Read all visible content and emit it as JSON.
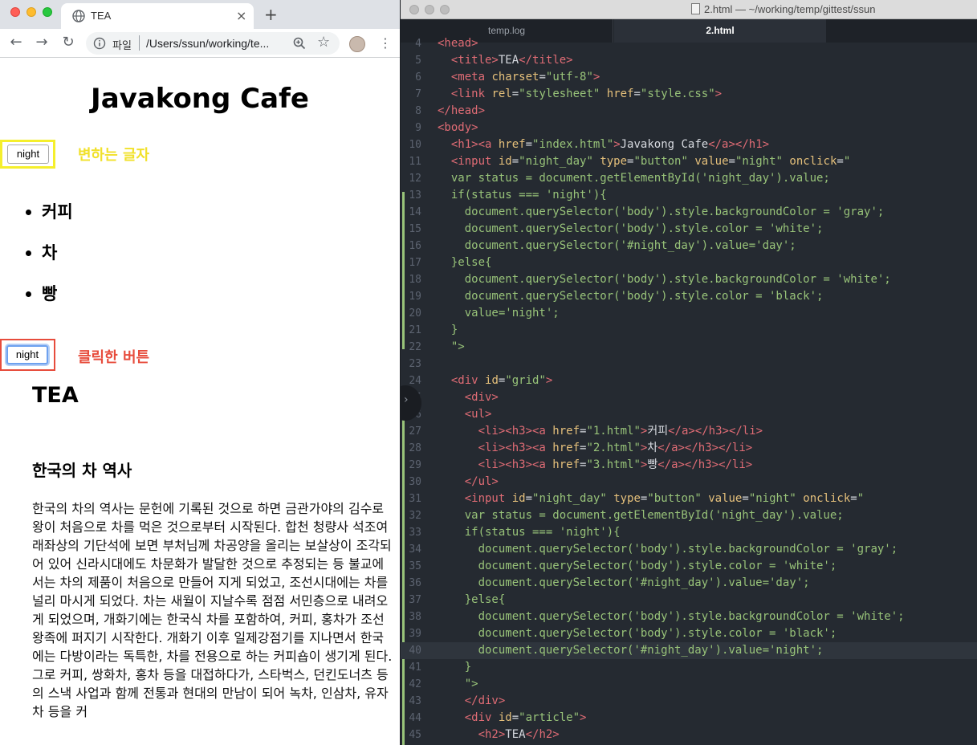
{
  "browser": {
    "tab_title": "TEA",
    "tab_close": "×",
    "new_tab": "+",
    "omnibox_file_label": "파일",
    "omnibox_url": "/Users/ssun/working/te...",
    "back": "←",
    "forward": "→",
    "reload": "↻",
    "star": "☆",
    "menu": "⋮"
  },
  "page": {
    "site_title": "Javakong Cafe",
    "night_button_top": "night",
    "callout_changing_text": "변하는 글자",
    "menu_items": [
      "커피",
      "차",
      "빵"
    ],
    "night_button_clicked": "night",
    "callout_clicked_button": "클릭한 버튼",
    "article_title": "TEA",
    "article_subtitle": "한국의 차 역사",
    "article_body": "한국의 차의 역사는 문헌에 기록된 것으로 하면 금관가야의 김수로 왕이 처음으로 차를 먹은 것으로부터 시작된다. 합천 청량사 석조여래좌상의 기단석에 보면 부처님께 차공양을 올리는 보살상이 조각되어 있어 신라시대에도 차문화가 발달한 것으로 추정되는 등 불교에서는 차의 제품이 처음으로 만들어 지게 되었고, 조선시대에는 차를 널리 마시게 되었다. 차는 새월이 지날수록 점점 서민층으로 내려오게 되었으며, 개화기에는 한국식 차를 포함하여, 커피, 홍차가 조선 왕족에 퍼지기 시작한다. 개화기 이후 일제강점기를 지나면서 한국에는 다방이라는 독특한, 차를 전용으로 하는 커피숍이 생기게 된다. 그로 커피, 쌍화차, 홍차 등을 대접하다가, 스타벅스, 던킨도너츠 등의 스낵 사업과 함께 전통과 현대의 만남이 되어 녹차, 인삼차, 유자차 등을 커"
  },
  "editor": {
    "window_title": "2.html — ~/working/temp/gittest/ssun",
    "tabs": [
      "temp.log",
      "2.html"
    ],
    "active_tab": "2.html",
    "lines": [
      {
        "n": "4",
        "t": [
          [
            "tag",
            "<head>"
          ]
        ]
      },
      {
        "n": "5",
        "t": [
          [
            "txt",
            "  "
          ],
          [
            "tag",
            "<title>"
          ],
          [
            "txt",
            "TEA"
          ],
          [
            "tag",
            "</title>"
          ]
        ]
      },
      {
        "n": "6",
        "t": [
          [
            "txt",
            "  "
          ],
          [
            "tag",
            "<meta "
          ],
          [
            "attr",
            "charset"
          ],
          [
            "txt",
            "="
          ],
          [
            "str",
            "\"utf-8\""
          ],
          [
            "tag",
            ">"
          ]
        ]
      },
      {
        "n": "7",
        "t": [
          [
            "txt",
            "  "
          ],
          [
            "tag",
            "<link "
          ],
          [
            "attr",
            "rel"
          ],
          [
            "txt",
            "="
          ],
          [
            "str",
            "\"stylesheet\""
          ],
          [
            "txt",
            " "
          ],
          [
            "attr",
            "href"
          ],
          [
            "txt",
            "="
          ],
          [
            "str",
            "\"style.css\""
          ],
          [
            "tag",
            ">"
          ]
        ]
      },
      {
        "n": "8",
        "t": [
          [
            "tag",
            "</head>"
          ]
        ]
      },
      {
        "n": "9",
        "t": [
          [
            "tag",
            "<body>"
          ]
        ]
      },
      {
        "n": "10",
        "t": [
          [
            "txt",
            "  "
          ],
          [
            "tag",
            "<h1><a "
          ],
          [
            "attr",
            "href"
          ],
          [
            "txt",
            "="
          ],
          [
            "str",
            "\"index.html\""
          ],
          [
            "tag",
            ">"
          ],
          [
            "txt",
            "Javakong Cafe"
          ],
          [
            "tag",
            "</a></h1>"
          ]
        ]
      },
      {
        "n": "11",
        "t": [
          [
            "txt",
            "  "
          ],
          [
            "tag",
            "<input "
          ],
          [
            "attr",
            "id"
          ],
          [
            "txt",
            "="
          ],
          [
            "str",
            "\"night_day\""
          ],
          [
            "txt",
            " "
          ],
          [
            "attr",
            "type"
          ],
          [
            "txt",
            "="
          ],
          [
            "str",
            "\"button\""
          ],
          [
            "txt",
            " "
          ],
          [
            "attr",
            "value"
          ],
          [
            "txt",
            "="
          ],
          [
            "str",
            "\"night\""
          ],
          [
            "txt",
            " "
          ],
          [
            "attr",
            "onclick"
          ],
          [
            "txt",
            "="
          ],
          [
            "str",
            "\""
          ]
        ]
      },
      {
        "n": "12",
        "t": [
          [
            "str",
            "  var status = document.getElementById('night_day').value;"
          ]
        ]
      },
      {
        "n": "13",
        "t": [
          [
            "str",
            "  if(status === 'night'){"
          ]
        ]
      },
      {
        "n": "14",
        "t": [
          [
            "str",
            "    document.querySelector('body').style.backgroundColor = 'gray';"
          ]
        ]
      },
      {
        "n": "15",
        "t": [
          [
            "str",
            "    document.querySelector('body').style.color = 'white';"
          ]
        ]
      },
      {
        "n": "16",
        "t": [
          [
            "str",
            "    document.querySelector('#night_day').value='day';"
          ]
        ]
      },
      {
        "n": "17",
        "t": [
          [
            "str",
            "  }else{"
          ]
        ]
      },
      {
        "n": "18",
        "t": [
          [
            "str",
            "    document.querySelector('body').style.backgroundColor = 'white';"
          ]
        ]
      },
      {
        "n": "19",
        "t": [
          [
            "str",
            "    document.querySelector('body').style.color = 'black';"
          ]
        ]
      },
      {
        "n": "20",
        "t": [
          [
            "str",
            "    value='night';"
          ]
        ]
      },
      {
        "n": "21",
        "t": [
          [
            "str",
            "  }"
          ]
        ]
      },
      {
        "n": "22",
        "t": [
          [
            "str",
            "  \">"
          ]
        ]
      },
      {
        "n": "23",
        "t": []
      },
      {
        "n": "24",
        "t": [
          [
            "txt",
            "  "
          ],
          [
            "tag",
            "<div "
          ],
          [
            "attr",
            "id"
          ],
          [
            "txt",
            "="
          ],
          [
            "str",
            "\"grid\""
          ],
          [
            "tag",
            ">"
          ]
        ]
      },
      {
        "n": "25",
        "t": [
          [
            "txt",
            "    "
          ],
          [
            "tag",
            "<div>"
          ]
        ]
      },
      {
        "n": "26",
        "t": [
          [
            "txt",
            "    "
          ],
          [
            "tag",
            "<ul>"
          ]
        ]
      },
      {
        "n": "27",
        "t": [
          [
            "txt",
            "      "
          ],
          [
            "tag",
            "<li><h3><a "
          ],
          [
            "attr",
            "href"
          ],
          [
            "txt",
            "="
          ],
          [
            "str",
            "\"1.html\""
          ],
          [
            "tag",
            ">"
          ],
          [
            "txt",
            "커피"
          ],
          [
            "tag",
            "</a></h3></li>"
          ]
        ]
      },
      {
        "n": "28",
        "t": [
          [
            "txt",
            "      "
          ],
          [
            "tag",
            "<li><h3><a "
          ],
          [
            "attr",
            "href"
          ],
          [
            "txt",
            "="
          ],
          [
            "str",
            "\"2.html\""
          ],
          [
            "tag",
            ">"
          ],
          [
            "txt",
            "차"
          ],
          [
            "tag",
            "</a></h3></li>"
          ]
        ]
      },
      {
        "n": "29",
        "t": [
          [
            "txt",
            "      "
          ],
          [
            "tag",
            "<li><h3><a "
          ],
          [
            "attr",
            "href"
          ],
          [
            "txt",
            "="
          ],
          [
            "str",
            "\"3.html\""
          ],
          [
            "tag",
            ">"
          ],
          [
            "txt",
            "빵"
          ],
          [
            "tag",
            "</a></h3></li>"
          ]
        ]
      },
      {
        "n": "30",
        "t": [
          [
            "txt",
            "    "
          ],
          [
            "tag",
            "</ul>"
          ]
        ]
      },
      {
        "n": "31",
        "t": [
          [
            "txt",
            "    "
          ],
          [
            "tag",
            "<input "
          ],
          [
            "attr",
            "id"
          ],
          [
            "txt",
            "="
          ],
          [
            "str",
            "\"night_day\""
          ],
          [
            "txt",
            " "
          ],
          [
            "attr",
            "type"
          ],
          [
            "txt",
            "="
          ],
          [
            "str",
            "\"button\""
          ],
          [
            "txt",
            " "
          ],
          [
            "attr",
            "value"
          ],
          [
            "txt",
            "="
          ],
          [
            "str",
            "\"night\""
          ],
          [
            "txt",
            " "
          ],
          [
            "attr",
            "onclick"
          ],
          [
            "txt",
            "="
          ],
          [
            "str",
            "\""
          ]
        ]
      },
      {
        "n": "32",
        "t": [
          [
            "str",
            "    var status = document.getElementById('night_day').value;"
          ]
        ]
      },
      {
        "n": "33",
        "t": [
          [
            "str",
            "    if(status === 'night'){"
          ]
        ]
      },
      {
        "n": "34",
        "t": [
          [
            "str",
            "      document.querySelector('body').style.backgroundColor = 'gray';"
          ]
        ]
      },
      {
        "n": "35",
        "t": [
          [
            "str",
            "      document.querySelector('body').style.color = 'white';"
          ]
        ]
      },
      {
        "n": "36",
        "t": [
          [
            "str",
            "      document.querySelector('#night_day').value='day';"
          ]
        ]
      },
      {
        "n": "37",
        "t": [
          [
            "str",
            "    }else{"
          ]
        ]
      },
      {
        "n": "38",
        "t": [
          [
            "str",
            "      document.querySelector('body').style.backgroundColor = 'white';"
          ]
        ]
      },
      {
        "n": "39",
        "t": [
          [
            "str",
            "      document.querySelector('body').style.color = 'black';"
          ]
        ]
      },
      {
        "n": "40",
        "t": [
          [
            "str",
            "      document.querySelector('#night_day').value='night';"
          ]
        ]
      },
      {
        "n": "41",
        "t": [
          [
            "str",
            "    }"
          ]
        ]
      },
      {
        "n": "42",
        "t": [
          [
            "str",
            "    \">"
          ]
        ]
      },
      {
        "n": "43",
        "t": [
          [
            "txt",
            "    "
          ],
          [
            "tag",
            "</div>"
          ]
        ]
      },
      {
        "n": "44",
        "t": [
          [
            "txt",
            "    "
          ],
          [
            "tag",
            "<div "
          ],
          [
            "attr",
            "id"
          ],
          [
            "txt",
            "="
          ],
          [
            "str",
            "\"article\""
          ],
          [
            "tag",
            ">"
          ]
        ]
      },
      {
        "n": "45",
        "t": [
          [
            "txt",
            "      "
          ],
          [
            "tag",
            "<h2>"
          ],
          [
            "txt",
            "TEA"
          ],
          [
            "tag",
            "</h2>"
          ]
        ]
      }
    ],
    "active_line": "40"
  },
  "colors": {
    "callout_yellow": "#f1e12b",
    "callout_red": "#e74c3c",
    "editor_bg": "#252a31",
    "tag": "#e06c75",
    "attr": "#e5c07b",
    "string": "#98c379"
  }
}
